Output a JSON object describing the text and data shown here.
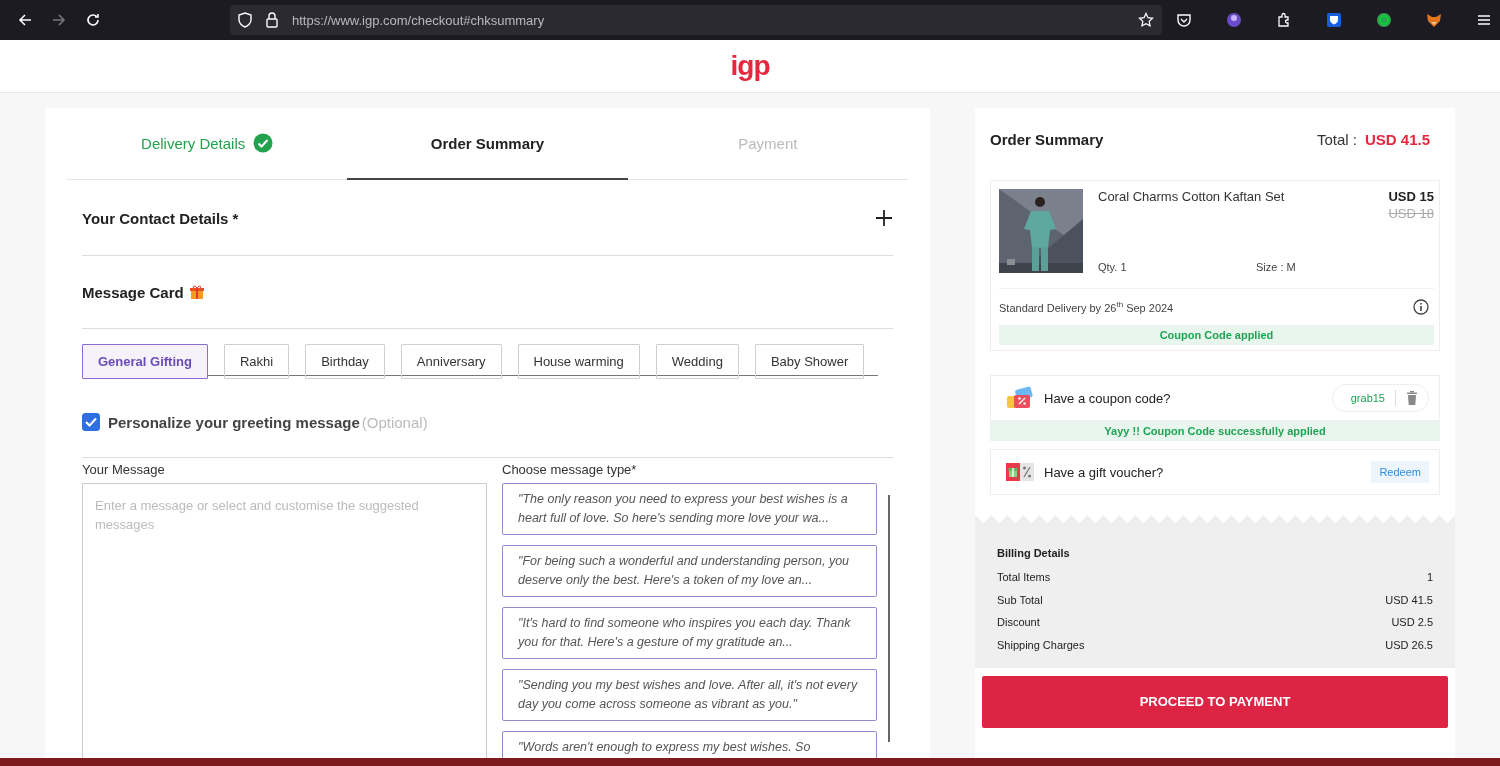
{
  "browser": {
    "url": "https://www.igp.com/checkout#chksummary"
  },
  "logo": "igp",
  "steps": [
    {
      "label": "Delivery Details",
      "selected": false,
      "done": true
    },
    {
      "label": "Order Summary",
      "selected": true,
      "done": false
    },
    {
      "label": "Payment",
      "selected": false,
      "done": false
    }
  ],
  "contact": {
    "title": "Your Contact Details *",
    "expanded": false
  },
  "message_card": {
    "title": "Message Card",
    "occasions": [
      {
        "label": "General Gifting",
        "selected": true
      },
      {
        "label": "Rakhi",
        "selected": false
      },
      {
        "label": "Birthday",
        "selected": false
      },
      {
        "label": "Anniversary",
        "selected": false
      },
      {
        "label": "House warming",
        "selected": false
      },
      {
        "label": "Wedding",
        "selected": false
      },
      {
        "label": "Baby Shower",
        "selected": false
      }
    ],
    "personalize": {
      "label": "Personalize your greeting message",
      "hint": "(Optional)",
      "checked": true
    },
    "your_message": {
      "label": "Your Message",
      "placeholder": "Enter a message or select and customise the suggested messages"
    },
    "message_types": {
      "label": "Choose message type*",
      "options": [
        "\"The only reason you need to express your best wishes is a heart full of love. So here's sending more love your wa...",
        "\"For being such a wonderful and understanding person, you deserve only the best. Here's a token of my love an...",
        "\"It's hard to find someone who inspires you each day. Thank you for that. Here's a gesture of my gratitude an...",
        "\"Sending you my best wishes and love. After all, it's not every day you come across someone as vibrant as you.\"",
        "\"Words aren't enough to express my best wishes. So"
      ]
    }
  },
  "summary": {
    "title": "Order Summary",
    "total_label": "Total :",
    "total": "USD 41.5",
    "item": {
      "kind": "picture",
      "name": "Coral Charms Cotton Kaftan Set",
      "price": "USD 15",
      "old_price": "USD 18",
      "qty": "Qty. 1",
      "size": "Size : M"
    },
    "delivery": "Standard Delivery by 26$^{th}$ Sep 2024",
    "coupon_status": "Coupon Code applied",
    "coupon": {
      "label": "Have a coupon code?",
      "code": "grab15",
      "message": "Yayy !! Coupon Code successfully applied"
    },
    "voucher": {
      "label": "Have a gift voucher?",
      "action": "Redeem"
    },
    "billing": {
      "title": "Billing Details",
      "rows": [
        {
          "label": "Total Items",
          "value": "1"
        },
        {
          "label": "Sub Total",
          "value": "USD 41.5"
        },
        {
          "label": "Discount",
          "value": "USD 2.5"
        },
        {
          "label": "Shipping Charges",
          "value": "USD 26.5"
        }
      ]
    },
    "proceed": "PROCEED TO PAYMENT"
  }
}
